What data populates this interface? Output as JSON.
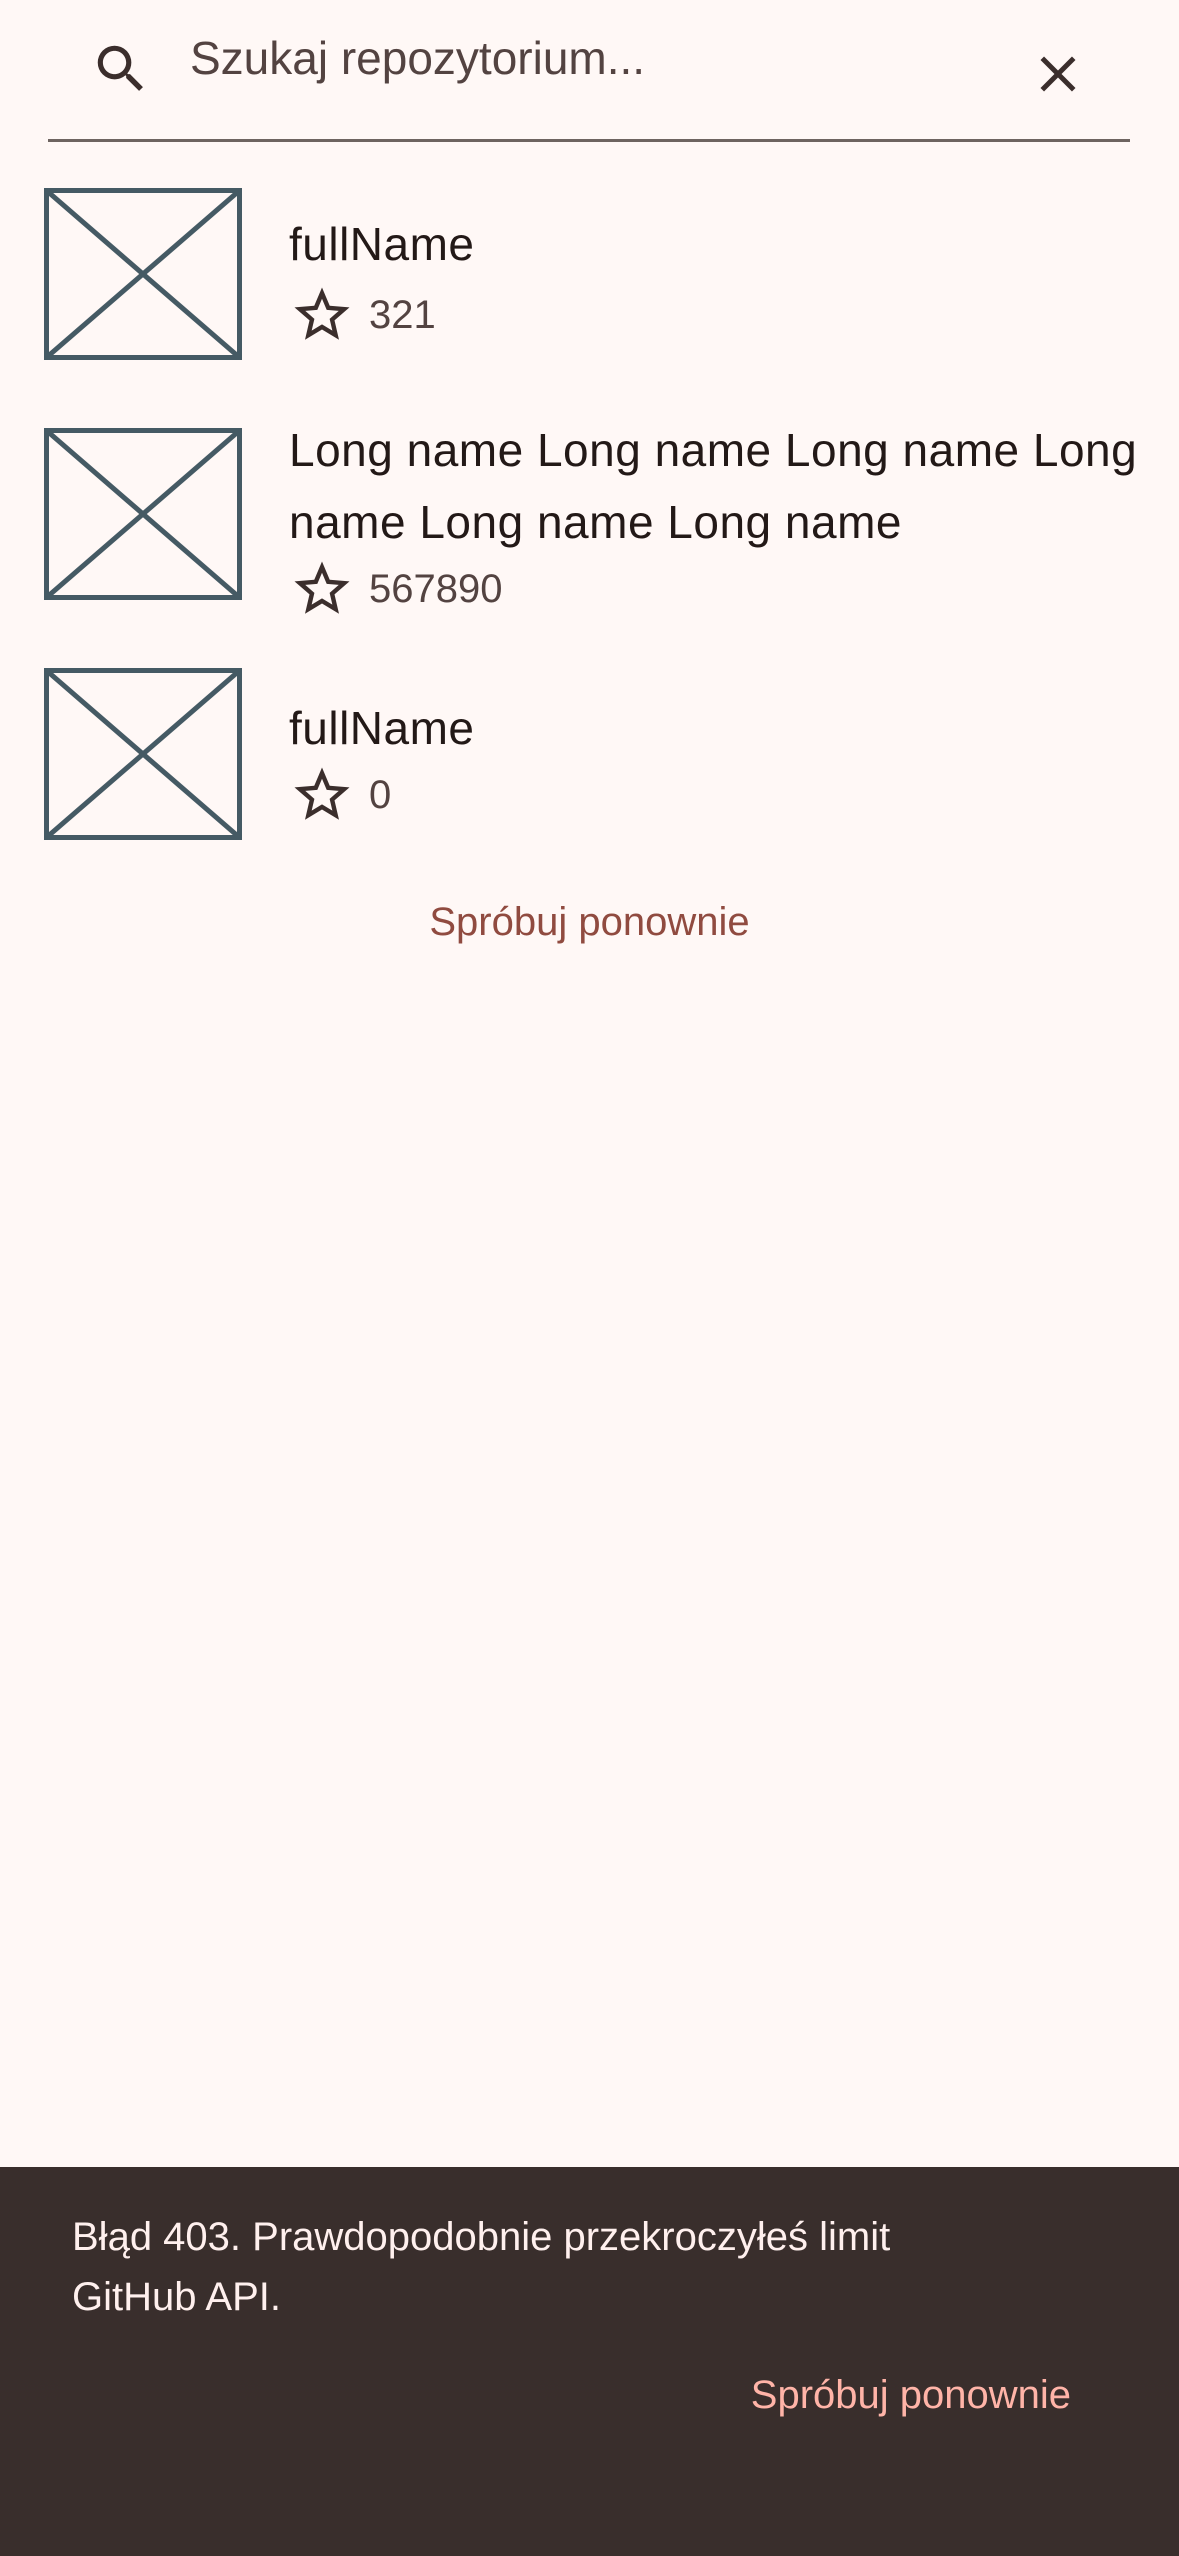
{
  "search": {
    "placeholder": "Szukaj repozytorium...",
    "value": ""
  },
  "repositories": [
    {
      "name": "fullName",
      "stars": "321"
    },
    {
      "name": "Long name Long name Long name Long name Long name Long name",
      "stars": "567890"
    },
    {
      "name": "fullName",
      "stars": "0"
    }
  ],
  "retry_inline_label": "Spróbuj ponownie",
  "snackbar": {
    "message": "Błąd 403. Prawdopodobnie przekroczyłeś limit GitHub API.",
    "action_label": "Spróbuj ponownie"
  },
  "icons": {
    "search": "search-icon",
    "clear": "close-icon",
    "star": "star-outline-icon",
    "thumbnail": "image-placeholder-icon"
  },
  "colors": {
    "background": "#fff8f6",
    "text": "#231917",
    "accent": "#904b40",
    "snackbar_bg": "#392e2c",
    "snackbar_action": "#ffb4a8",
    "placeholder_stroke": "#455a64"
  }
}
